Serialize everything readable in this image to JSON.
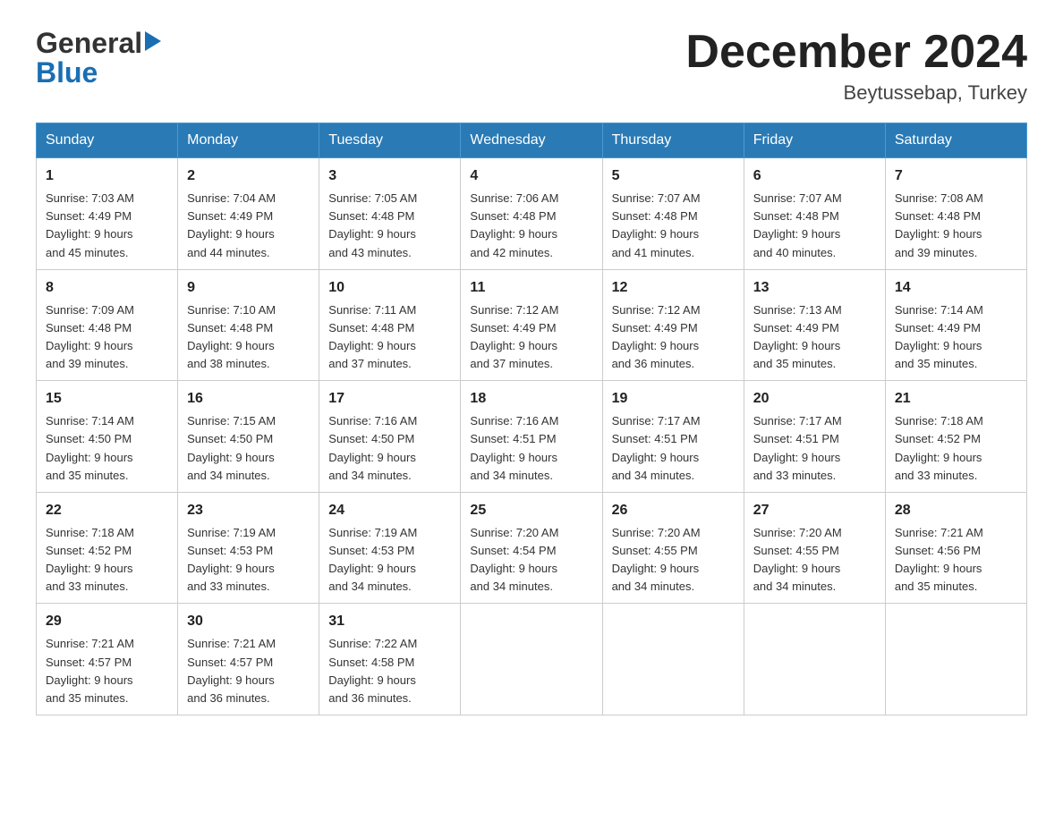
{
  "logo": {
    "general": "General",
    "blue": "Blue",
    "triangle": "▶"
  },
  "title": "December 2024",
  "location": "Beytussebap, Turkey",
  "headers": [
    "Sunday",
    "Monday",
    "Tuesday",
    "Wednesday",
    "Thursday",
    "Friday",
    "Saturday"
  ],
  "weeks": [
    [
      {
        "day": "1",
        "sunrise": "7:03 AM",
        "sunset": "4:49 PM",
        "daylight": "9 hours and 45 minutes."
      },
      {
        "day": "2",
        "sunrise": "7:04 AM",
        "sunset": "4:49 PM",
        "daylight": "9 hours and 44 minutes."
      },
      {
        "day": "3",
        "sunrise": "7:05 AM",
        "sunset": "4:48 PM",
        "daylight": "9 hours and 43 minutes."
      },
      {
        "day": "4",
        "sunrise": "7:06 AM",
        "sunset": "4:48 PM",
        "daylight": "9 hours and 42 minutes."
      },
      {
        "day": "5",
        "sunrise": "7:07 AM",
        "sunset": "4:48 PM",
        "daylight": "9 hours and 41 minutes."
      },
      {
        "day": "6",
        "sunrise": "7:07 AM",
        "sunset": "4:48 PM",
        "daylight": "9 hours and 40 minutes."
      },
      {
        "day": "7",
        "sunrise": "7:08 AM",
        "sunset": "4:48 PM",
        "daylight": "9 hours and 39 minutes."
      }
    ],
    [
      {
        "day": "8",
        "sunrise": "7:09 AM",
        "sunset": "4:48 PM",
        "daylight": "9 hours and 39 minutes."
      },
      {
        "day": "9",
        "sunrise": "7:10 AM",
        "sunset": "4:48 PM",
        "daylight": "9 hours and 38 minutes."
      },
      {
        "day": "10",
        "sunrise": "7:11 AM",
        "sunset": "4:48 PM",
        "daylight": "9 hours and 37 minutes."
      },
      {
        "day": "11",
        "sunrise": "7:12 AM",
        "sunset": "4:49 PM",
        "daylight": "9 hours and 37 minutes."
      },
      {
        "day": "12",
        "sunrise": "7:12 AM",
        "sunset": "4:49 PM",
        "daylight": "9 hours and 36 minutes."
      },
      {
        "day": "13",
        "sunrise": "7:13 AM",
        "sunset": "4:49 PM",
        "daylight": "9 hours and 35 minutes."
      },
      {
        "day": "14",
        "sunrise": "7:14 AM",
        "sunset": "4:49 PM",
        "daylight": "9 hours and 35 minutes."
      }
    ],
    [
      {
        "day": "15",
        "sunrise": "7:14 AM",
        "sunset": "4:50 PM",
        "daylight": "9 hours and 35 minutes."
      },
      {
        "day": "16",
        "sunrise": "7:15 AM",
        "sunset": "4:50 PM",
        "daylight": "9 hours and 34 minutes."
      },
      {
        "day": "17",
        "sunrise": "7:16 AM",
        "sunset": "4:50 PM",
        "daylight": "9 hours and 34 minutes."
      },
      {
        "day": "18",
        "sunrise": "7:16 AM",
        "sunset": "4:51 PM",
        "daylight": "9 hours and 34 minutes."
      },
      {
        "day": "19",
        "sunrise": "7:17 AM",
        "sunset": "4:51 PM",
        "daylight": "9 hours and 34 minutes."
      },
      {
        "day": "20",
        "sunrise": "7:17 AM",
        "sunset": "4:51 PM",
        "daylight": "9 hours and 33 minutes."
      },
      {
        "day": "21",
        "sunrise": "7:18 AM",
        "sunset": "4:52 PM",
        "daylight": "9 hours and 33 minutes."
      }
    ],
    [
      {
        "day": "22",
        "sunrise": "7:18 AM",
        "sunset": "4:52 PM",
        "daylight": "9 hours and 33 minutes."
      },
      {
        "day": "23",
        "sunrise": "7:19 AM",
        "sunset": "4:53 PM",
        "daylight": "9 hours and 33 minutes."
      },
      {
        "day": "24",
        "sunrise": "7:19 AM",
        "sunset": "4:53 PM",
        "daylight": "9 hours and 34 minutes."
      },
      {
        "day": "25",
        "sunrise": "7:20 AM",
        "sunset": "4:54 PM",
        "daylight": "9 hours and 34 minutes."
      },
      {
        "day": "26",
        "sunrise": "7:20 AM",
        "sunset": "4:55 PM",
        "daylight": "9 hours and 34 minutes."
      },
      {
        "day": "27",
        "sunrise": "7:20 AM",
        "sunset": "4:55 PM",
        "daylight": "9 hours and 34 minutes."
      },
      {
        "day": "28",
        "sunrise": "7:21 AM",
        "sunset": "4:56 PM",
        "daylight": "9 hours and 35 minutes."
      }
    ],
    [
      {
        "day": "29",
        "sunrise": "7:21 AM",
        "sunset": "4:57 PM",
        "daylight": "9 hours and 35 minutes."
      },
      {
        "day": "30",
        "sunrise": "7:21 AM",
        "sunset": "4:57 PM",
        "daylight": "9 hours and 36 minutes."
      },
      {
        "day": "31",
        "sunrise": "7:22 AM",
        "sunset": "4:58 PM",
        "daylight": "9 hours and 36 minutes."
      },
      null,
      null,
      null,
      null
    ]
  ],
  "labels": {
    "sunrise_prefix": "Sunrise: ",
    "sunset_prefix": "Sunset: ",
    "daylight_prefix": "Daylight: "
  }
}
